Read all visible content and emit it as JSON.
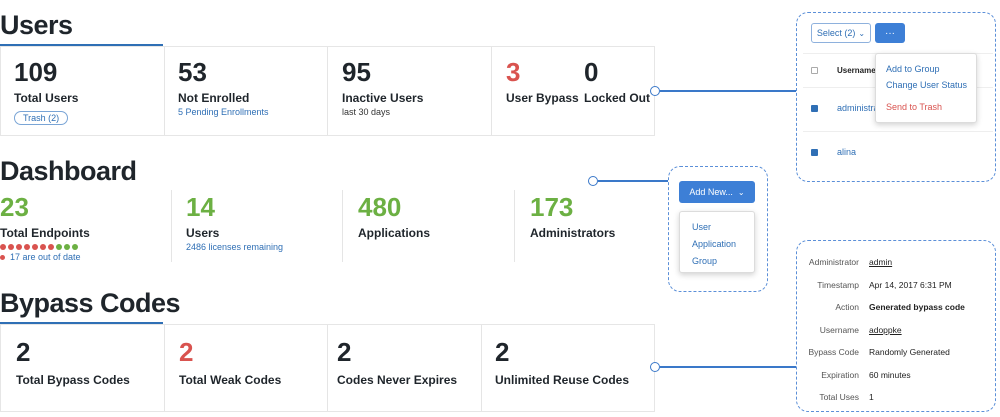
{
  "users": {
    "title": "Users",
    "stats": [
      {
        "value": "109",
        "label": "Total Users",
        "pill": "Trash (2)"
      },
      {
        "value": "53",
        "label": "Not Enrolled",
        "sub": "5 Pending Enrollments"
      },
      {
        "value": "95",
        "label": "Inactive Users",
        "sub": "last 30 days"
      },
      {
        "value": "3",
        "label": "User Bypass"
      },
      {
        "value": "0",
        "label": "Locked Out"
      }
    ]
  },
  "dashboard": {
    "title": "Dashboard",
    "stats": [
      {
        "value": "23",
        "label": "Total Endpoints",
        "sub": "17 are out of date"
      },
      {
        "value": "14",
        "label": "Users",
        "sub": "2486 licenses remaining"
      },
      {
        "value": "480",
        "label": "Applications"
      },
      {
        "value": "173",
        "label": "Administrators"
      }
    ]
  },
  "bypass": {
    "title": "Bypass Codes",
    "stats": [
      {
        "value": "2",
        "label": "Total Bypass Codes"
      },
      {
        "value": "2",
        "label": "Total Weak Codes"
      },
      {
        "value": "2",
        "label": "Codes Never Expires"
      },
      {
        "value": "2",
        "label": "Unlimited Reuse Codes"
      }
    ]
  },
  "select_panel": {
    "select_label": "Select (2)",
    "more_label": "···",
    "column_username": "Username",
    "rows": [
      "administra",
      "alina"
    ],
    "menu": [
      "Add to Group",
      "Change User Status",
      "Send to Trash"
    ]
  },
  "add_new": {
    "label": "Add New...",
    "menu": [
      "User",
      "Application",
      "Group"
    ]
  },
  "details": [
    {
      "key": "Administrator",
      "value": "admin"
    },
    {
      "key": "Timestamp",
      "value": "Apr 14, 2017 6:31 PM"
    },
    {
      "key": "Action",
      "value": "Generated bypass code"
    },
    {
      "key": "Username",
      "value": "adoppke"
    },
    {
      "key": "Bypass Code",
      "value": "Randomly Generated"
    },
    {
      "key": "Expiration",
      "value": "60 minutes"
    },
    {
      "key": "Total Uses",
      "value": "1"
    }
  ],
  "colors": {
    "accent": "#3d7fd6",
    "red": "#d9534f",
    "green": "#6cb043",
    "navy": "#2f6fb5"
  }
}
